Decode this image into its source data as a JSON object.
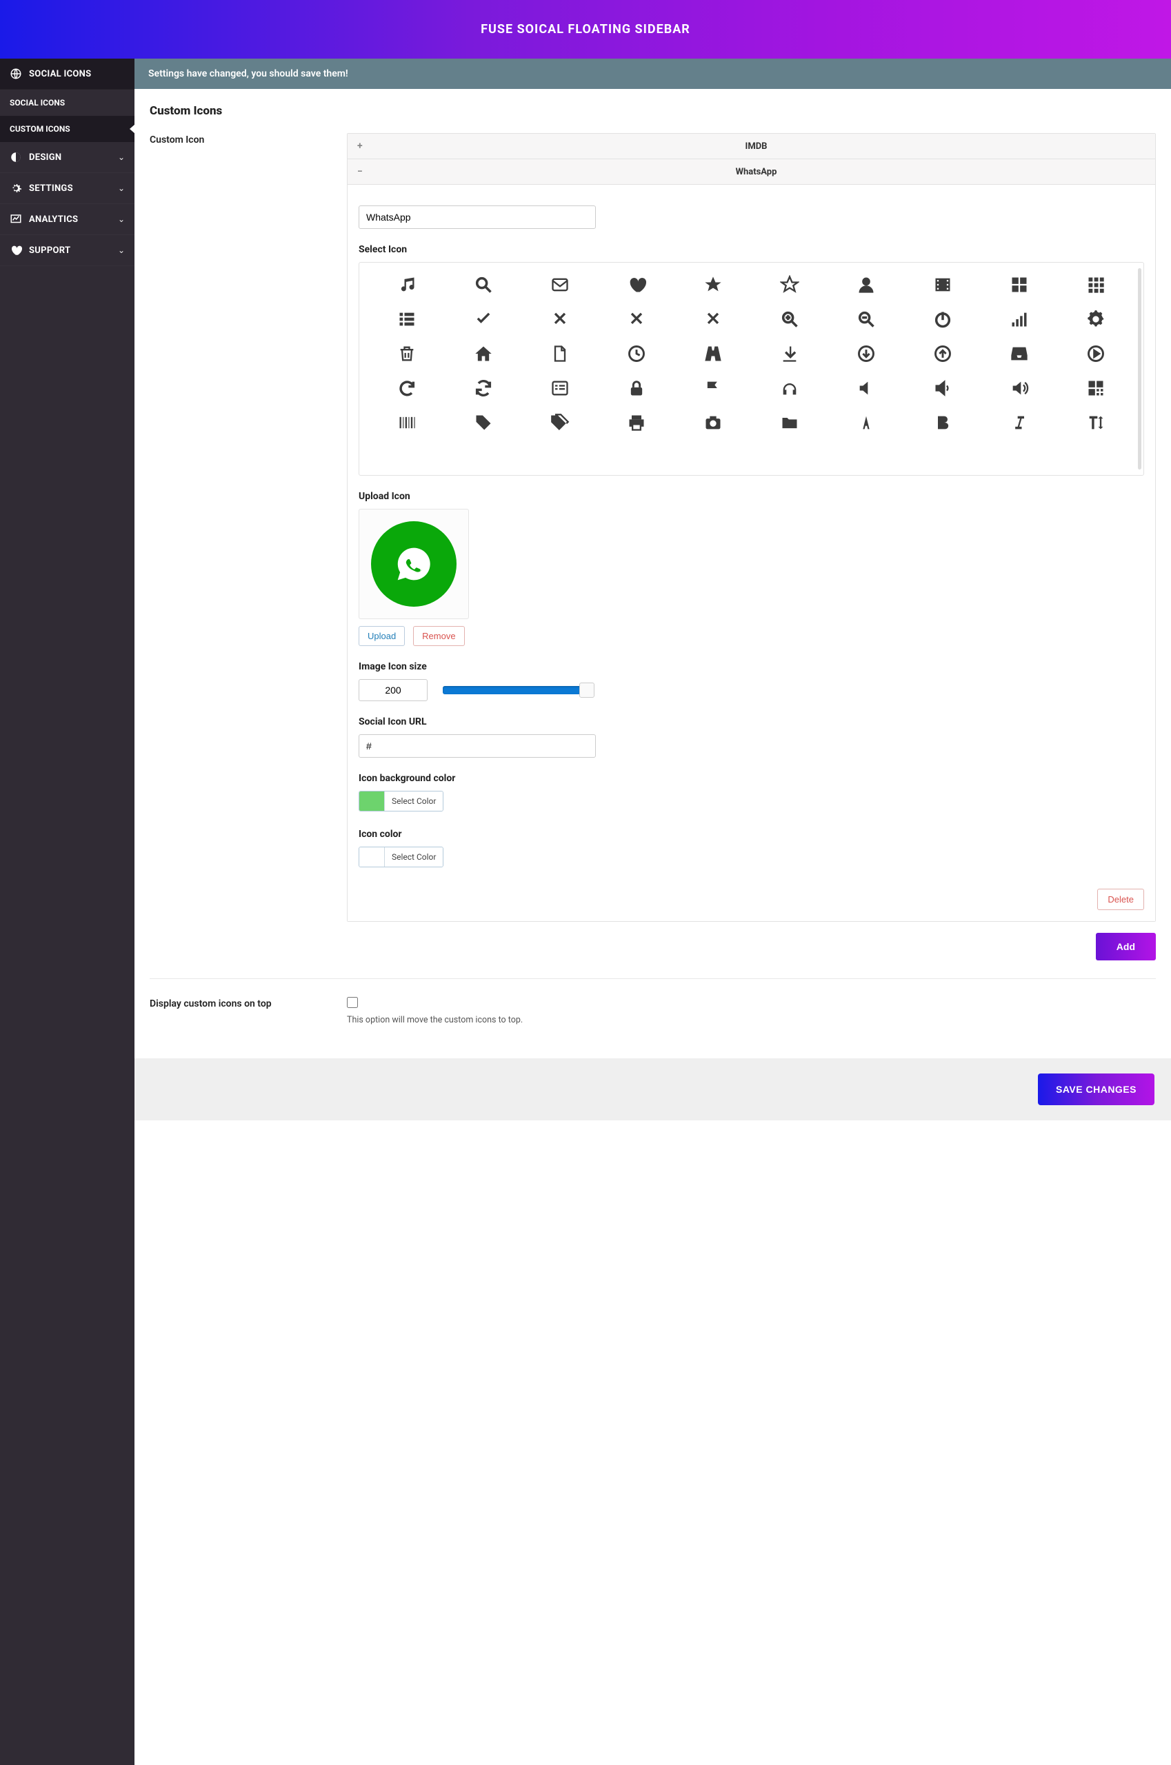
{
  "header": {
    "title": "FUSE SOICAL FLOATING SIDEBAR"
  },
  "notice": "Settings have changed, you should save them!",
  "page": {
    "title": "Custom Icons"
  },
  "sidebar": {
    "items": [
      {
        "label": "SOCIAL ICONS",
        "icon": "globe-icon"
      },
      {
        "label": "SOCIAL ICONS"
      },
      {
        "label": "CUSTOM ICONS"
      },
      {
        "label": "DESIGN",
        "icon": "contrast-icon"
      },
      {
        "label": "SETTINGS",
        "icon": "cogs-icon"
      },
      {
        "label": "ANALYTICS",
        "icon": "chart-icon"
      },
      {
        "label": "SUPPORT",
        "icon": "heart-icon"
      }
    ]
  },
  "form": {
    "custom_icon_label": "Custom Icon",
    "accordions": [
      {
        "title": "IMDB",
        "expanded": false
      },
      {
        "title": "WhatsApp",
        "expanded": true
      }
    ],
    "name_value": "WhatsApp",
    "select_icon_label": "Select Icon",
    "upload_icon_label": "Upload Icon",
    "upload_btn": "Upload",
    "remove_btn": "Remove",
    "image_size_label": "Image Icon size",
    "image_size_value": "200",
    "url_label": "Social Icon URL",
    "url_value": "#",
    "bg_color_label": "Icon background color",
    "icon_color_label": "Icon color",
    "select_color": "Select Color",
    "delete_btn": "Delete",
    "add_btn": "Add",
    "display_top_label": "Display custom icons on top",
    "display_top_desc": "This option will move the custom icons to top.",
    "save_btn": "SAVE CHANGES",
    "bg_color_value": "#6dd36d",
    "icon_color_value": "#ffffff"
  }
}
